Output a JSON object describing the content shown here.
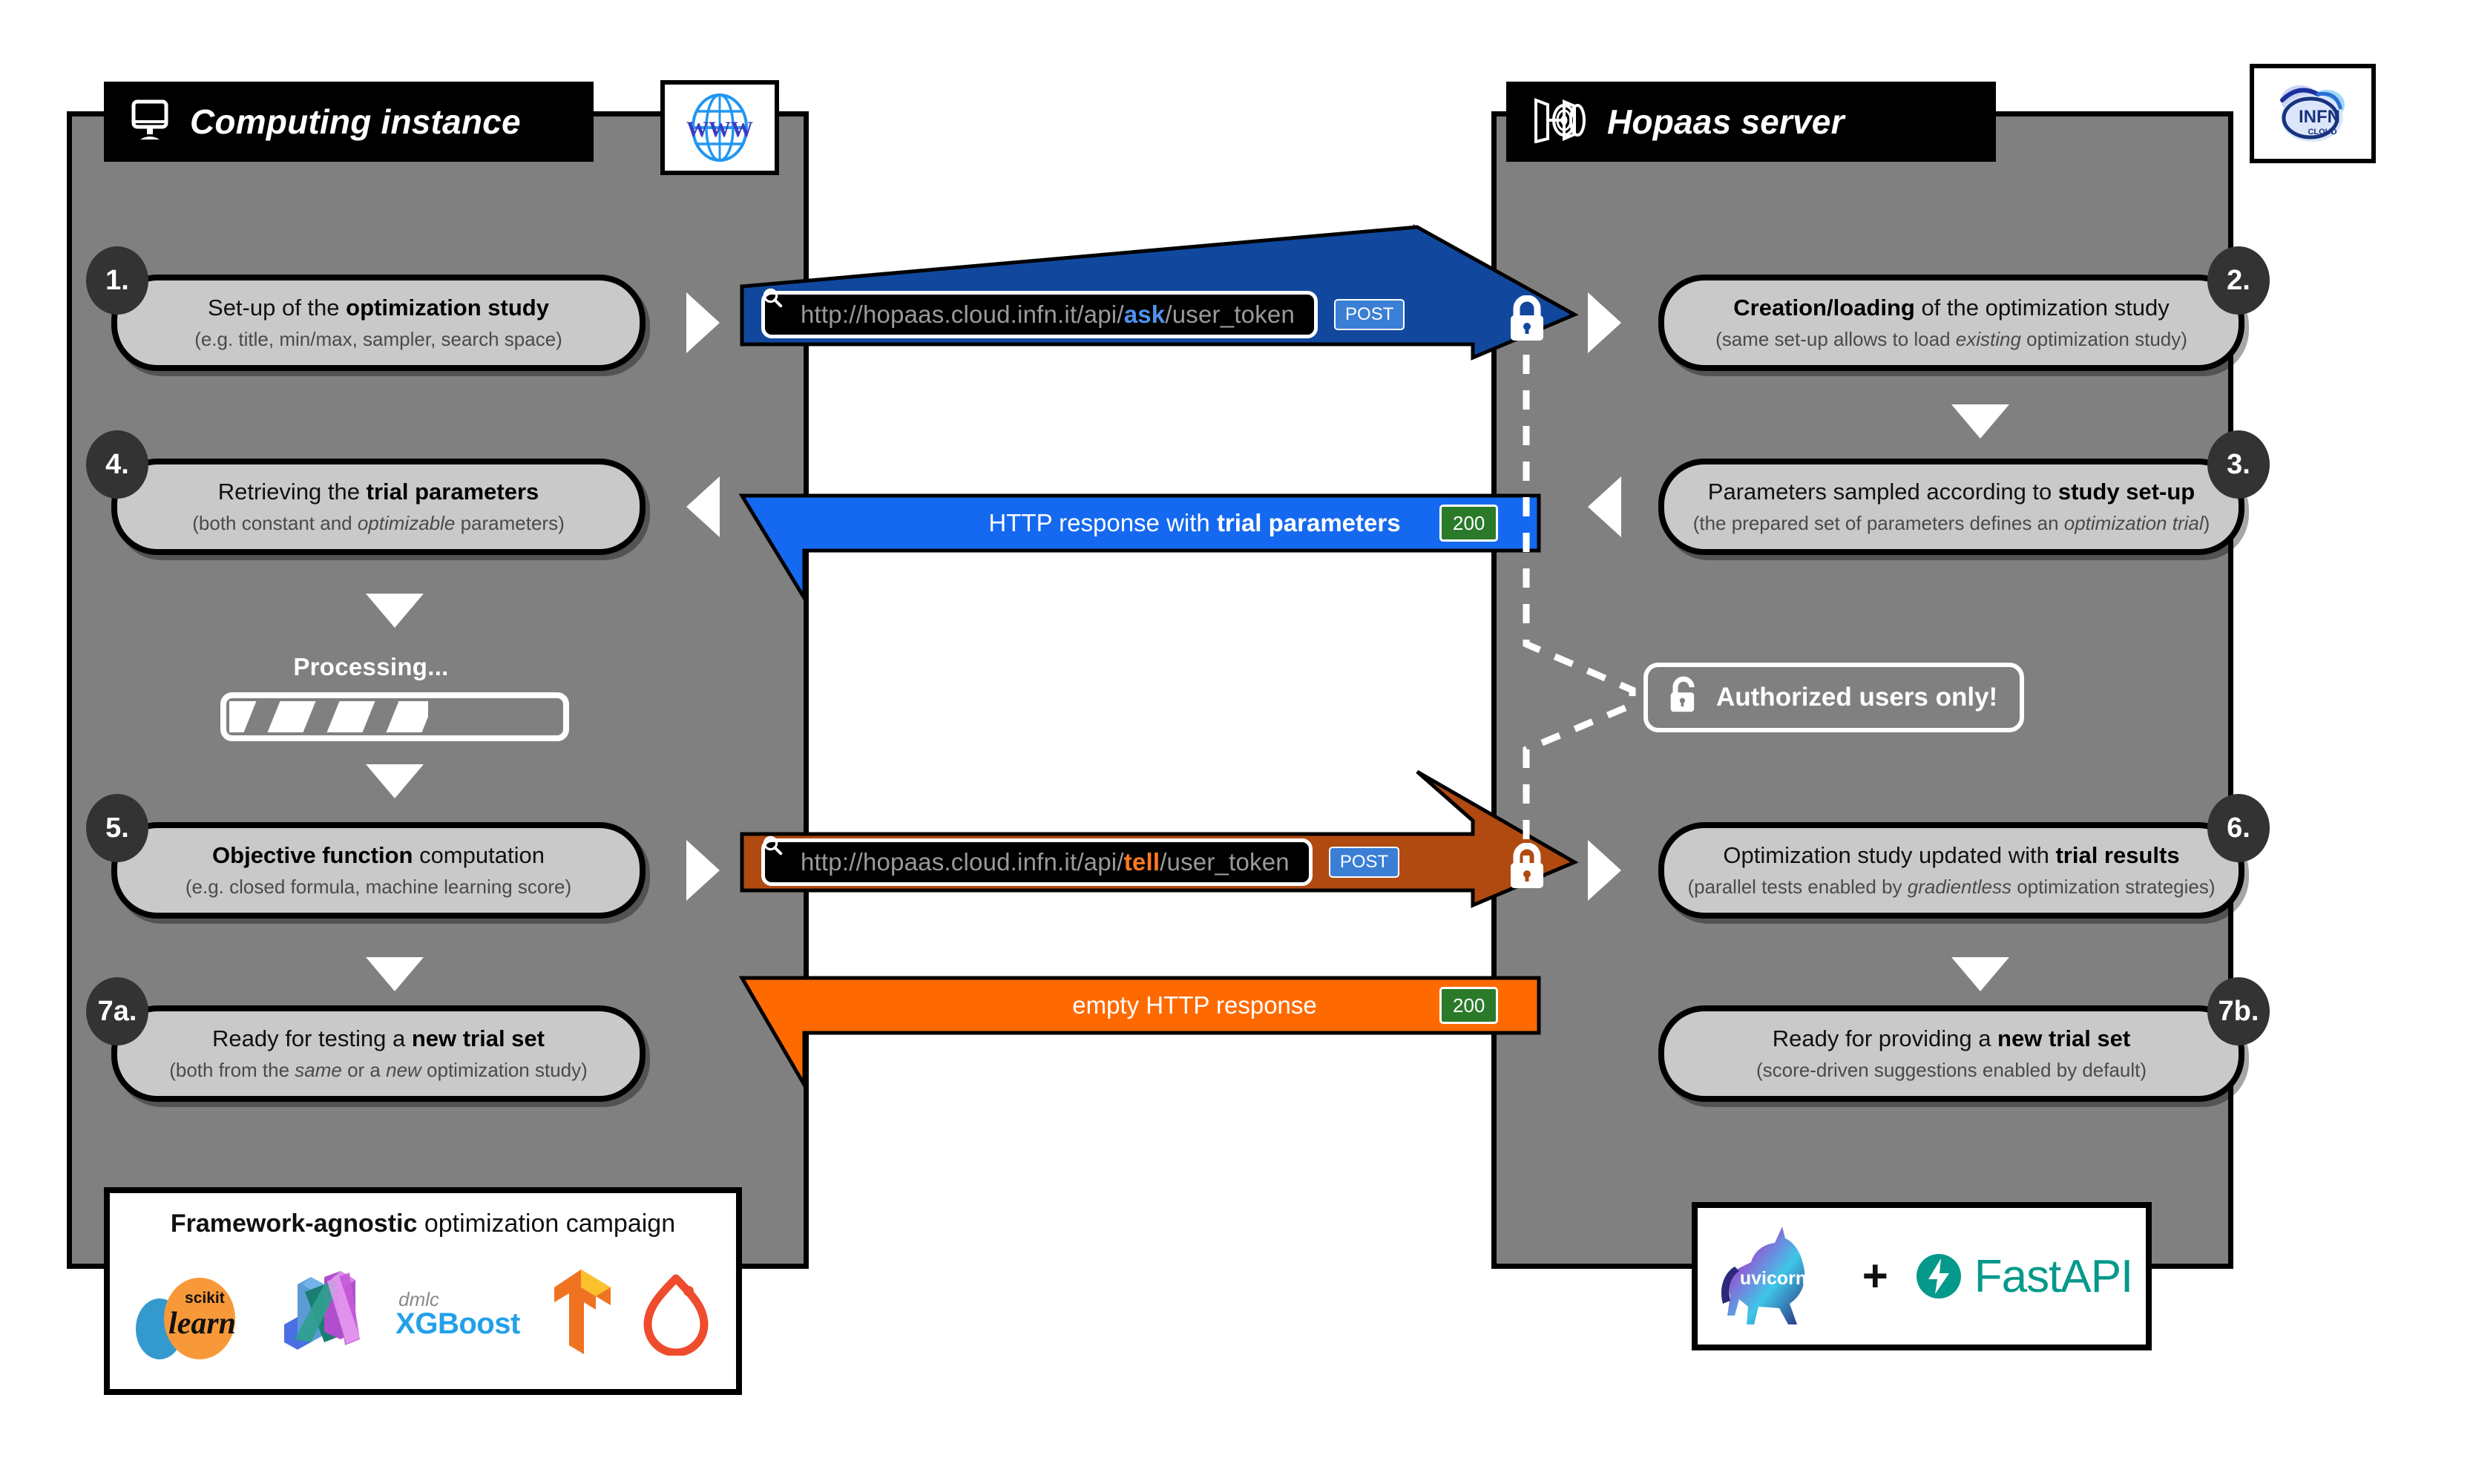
{
  "left_panel": {
    "title": "Computing instance",
    "icon": "monitor-icon",
    "corner_logo": "www-globe-logo",
    "corner_logo_text": "WWW",
    "steps": [
      {
        "num": "1.",
        "line1_pre": "Set-up of the ",
        "line1_bold": "optimization study",
        "line1_post": "",
        "line2": "(e.g. title, min/max, sampler, search space)"
      },
      {
        "num": "4.",
        "line1_pre": "Retrieving the ",
        "line1_bold": "trial parameters",
        "line1_post": "",
        "line2_a": "(both constant and ",
        "line2_i": "optimizable",
        "line2_b": " parameters)"
      },
      {
        "num": "5.",
        "line1_pre": "",
        "line1_bold": "Objective function",
        "line1_post": " computation",
        "line2": "(e.g. closed formula, machine learning score)"
      },
      {
        "num": "7a.",
        "line1_pre": "Ready for testing a ",
        "line1_bold": "new trial set",
        "line1_post": "",
        "line2_a": "(both from the ",
        "line2_i": "same",
        "line2_m": " or a ",
        "line2_i2": "new",
        "line2_b": " optimization study)"
      }
    ],
    "processing_label": "Processing...",
    "processing_percent": 59,
    "frameworks_box": {
      "title_bold": "Framework-agnostic",
      "title_rest": " optimization campaign",
      "logos": [
        "scikit-learn-logo",
        "jax-logo",
        "xgboost-logo",
        "tensorflow-logo",
        "pytorch-logo"
      ],
      "xgboost_top": "dmlc",
      "xgboost_name": "XGBoost",
      "sklearn_top": "scikit",
      "sklearn_name": "learn"
    }
  },
  "right_panel": {
    "title": "Hopaas server",
    "icon": "hopaas-logo",
    "corner_logo": "infn-cloud-logo",
    "corner_logo_text": "INFN",
    "corner_logo_sub": "CLOUD",
    "steps": [
      {
        "num": "2.",
        "line1_bold": "Creation/loading",
        "line1_post": " of the optimization study",
        "line2_a": "(same set-up allows to load ",
        "line2_i": "existing",
        "line2_b": " optimization study)"
      },
      {
        "num": "3.",
        "line1_pre": "Parameters sampled according to ",
        "line1_bold": "study set-up",
        "line1_post": "",
        "line2_a": "(the prepared set of parameters defines an ",
        "line2_i": "optimization trial",
        "line2_b": ")"
      },
      {
        "num": "6.",
        "line1_pre": "Optimization study updated with ",
        "line1_bold": "trial results",
        "line1_post": "",
        "line2_a": "(parallel tests enabled by ",
        "line2_i": "gradientless",
        "line2_b": " optimization strategies)"
      },
      {
        "num": "7b.",
        "line1_pre": "Ready for providing a ",
        "line1_bold": "new trial set",
        "line1_post": "",
        "line2": "(score-driven suggestions enabled by default)"
      }
    ],
    "server_box": {
      "uvicorn": "uvicorn",
      "plus": "+",
      "fastapi": "FastAPI"
    }
  },
  "messages": {
    "ask_request": {
      "url_prefix": "http://hopaas.cloud.infn.it/api/",
      "url_endpoint": "ask",
      "url_suffix": "/user_token",
      "method": "POST",
      "color": "#11489e",
      "endpoint_color": "#4f93f0",
      "lock": "closed-padlock-icon"
    },
    "ask_response": {
      "text_pre": "HTTP response with ",
      "text_bold": "trial parameters",
      "status": "200",
      "color": "#1569f0"
    },
    "tell_request": {
      "url_prefix": "http://hopaas.cloud.infn.it/api/",
      "url_endpoint": "tell",
      "url_suffix": "/user_token",
      "method": "POST",
      "color": "#b04a10",
      "endpoint_color": "#ff7a1f",
      "lock": "closed-padlock-icon"
    },
    "tell_response": {
      "text_pre": "empty HTTP response",
      "text_bold": "",
      "status": "200",
      "color": "#ff6a00"
    },
    "auth_note": {
      "text": "Authorized users only!",
      "icon": "open-padlock-icon"
    }
  },
  "colors": {
    "panel_bg": "#808080",
    "step_bg": "#c9c9c9",
    "badge_bg": "#333333",
    "status_green": "#2a7a2a",
    "verb_blue": "#3a7fd5",
    "fastapi_teal": "#05998b"
  }
}
